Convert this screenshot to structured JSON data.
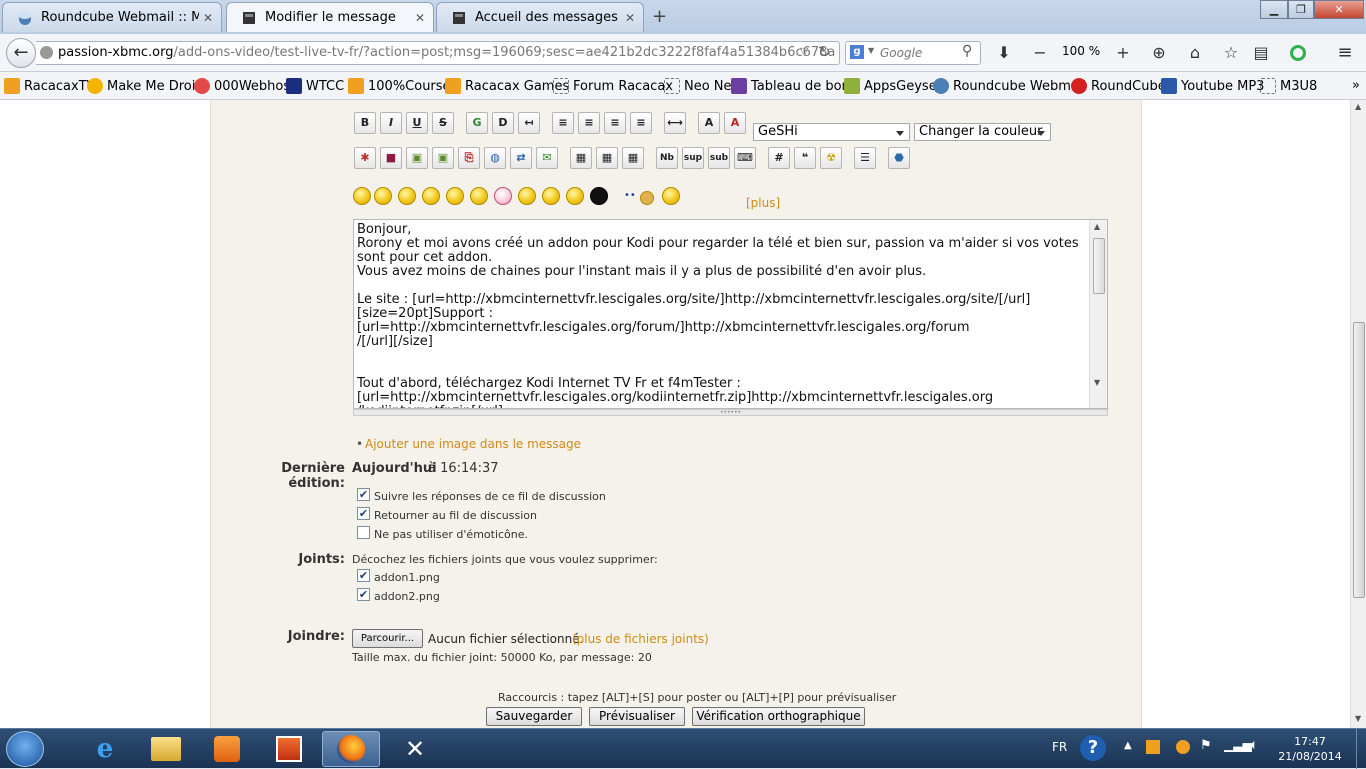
{
  "browser": {
    "tabs": [
      {
        "title": "Roundcube Webmail :: Me...",
        "active": false
      },
      {
        "title": "Modifier le message",
        "active": true
      },
      {
        "title": "Accueil des messages pers...",
        "active": false
      }
    ],
    "url": {
      "host": "passion-xbmc.org",
      "path": "/add-ons-video/test-live-tv-fr/?action=post;msg=196069;sesc=ae421b2dc3222f8faf4a51384b6c678a"
    },
    "search_placeholder": "Google",
    "zoom": "100 %",
    "bookmarks": [
      "RacacaxTV",
      "Make Me Droid",
      "000Webhost",
      "WTCC",
      "100%Courses",
      "Racacax Games",
      "Forum Racacax",
      "Neo Net",
      "Tableau de bord",
      "AppsGeyser",
      "Roundcube Webmail",
      "RoundCube",
      "Youtube MP3",
      "M3U8"
    ],
    "bookmarks_more": "»"
  },
  "editor": {
    "format_buttons": [
      "B",
      "I",
      "U",
      "S"
    ],
    "code_select": "GeSHi",
    "color_select": "Changer la couleur",
    "more_smileys": "[plus]",
    "body": "Bonjour,\nRorony et moi avons créé un addon pour Kodi pour regarder la télé et bien sur, passion va m'aider si vos votes sont pour cet addon.\nVous avez moins de chaines pour l'instant mais il y a plus de possibilité d'en avoir plus.\n\nLe site : [url=http://xbmcinternettvfr.lescigales.org/site/]http://xbmcinternettvfr.lescigales.org/site/[/url]\n[size=20pt]Support : [url=http://xbmcinternettvfr.lescigales.org/forum/]http://xbmcinternettvfr.lescigales.org/forum\n/[/url][/size]\n\n\nTout d'abord, téléchargez Kodi Internet TV Fr et f4mTester :\n[url=http://xbmcinternettvfr.lescigales.org/kodiinternetfr.zip]http://xbmcinternettvfr.lescigales.org\n/kodiinternetfr.zip[/url]",
    "add_image_link": "Ajouter une image dans le message"
  },
  "form": {
    "last_edit_label": "Dernière édition:",
    "last_edit_day": "Aujourd'hui",
    "last_edit_at": "à 16:14:37",
    "options": [
      {
        "label": "Suivre les réponses de ce fil de discussion",
        "checked": true
      },
      {
        "label": "Retourner au fil de discussion",
        "checked": true
      },
      {
        "label": "Ne pas utiliser d'émoticône.",
        "checked": false
      }
    ],
    "attachments_label": "Joints:",
    "attachments_hint": "Décochez les fichiers joints que vous voulez supprimer:",
    "attachments": [
      {
        "name": "addon1.png",
        "checked": true
      },
      {
        "name": "addon2.png",
        "checked": true
      }
    ],
    "attach_label": "Joindre:",
    "browse_button": "Parcourir...",
    "no_file": "Aucun fichier sélectionné.",
    "more_files": "(plus de fichiers joints)",
    "max_size": "Taille max. du fichier joint: 50000 Ko, par message: 20",
    "shortcuts": "Raccourcis : tapez [ALT]+[S] pour poster ou [ALT]+[P] pour prévisualiser",
    "save_button": "Sauvegarder",
    "preview_button": "Prévisualiser",
    "spellcheck_button": "Vérification orthographique"
  },
  "taskbar": {
    "lang": "FR",
    "time": "17:47",
    "date": "21/08/2014"
  }
}
